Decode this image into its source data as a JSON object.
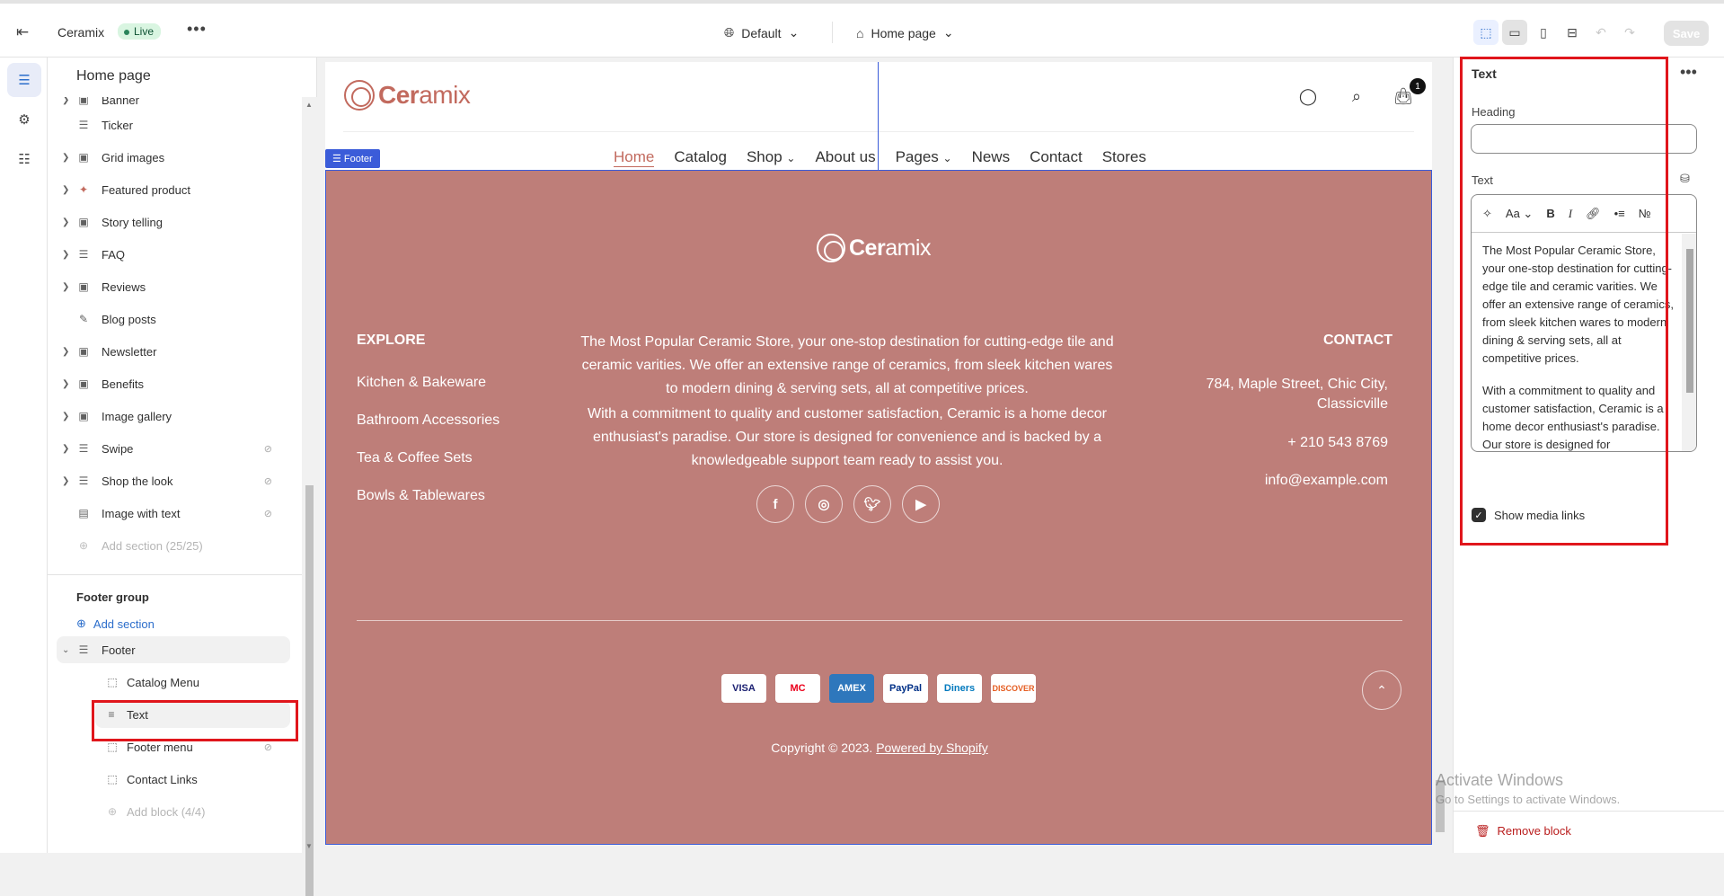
{
  "topbar": {
    "store_name": "Ceramix",
    "status": "Live",
    "theme_label": "Default",
    "page_label": "Home page",
    "save_label": "Save"
  },
  "sidebar": {
    "title": "Home page",
    "sections": [
      {
        "label": "Banner",
        "icon": "image-icon",
        "expandable": true,
        "hidden": false
      },
      {
        "label": "Ticker",
        "icon": "section-icon",
        "expandable": false,
        "hidden": false
      },
      {
        "label": "Grid images",
        "icon": "image-icon",
        "expandable": true,
        "hidden": false
      },
      {
        "label": "Featured product",
        "icon": "product-icon",
        "expandable": true,
        "hidden": false
      },
      {
        "label": "Story telling",
        "icon": "image-icon",
        "expandable": true,
        "hidden": false
      },
      {
        "label": "FAQ",
        "icon": "section-icon",
        "expandable": true,
        "hidden": false
      },
      {
        "label": "Reviews",
        "icon": "image-icon",
        "expandable": true,
        "hidden": false
      },
      {
        "label": "Blog posts",
        "icon": "blog-icon",
        "expandable": false,
        "hidden": false
      },
      {
        "label": "Newsletter",
        "icon": "image-icon",
        "expandable": true,
        "hidden": false
      },
      {
        "label": "Benefits",
        "icon": "image-icon",
        "expandable": true,
        "hidden": false
      },
      {
        "label": "Image gallery",
        "icon": "image-icon",
        "expandable": true,
        "hidden": false
      },
      {
        "label": "Swipe",
        "icon": "section-icon",
        "expandable": true,
        "hidden": true
      },
      {
        "label": "Shop the look",
        "icon": "section-icon",
        "expandable": true,
        "hidden": true
      },
      {
        "label": "Image with text",
        "icon": "image-text-icon",
        "expandable": false,
        "hidden": true
      }
    ],
    "add_section_limited": "Add section (25/25)",
    "footer_group_title": "Footer group",
    "add_section": "Add section",
    "footer_section": "Footer",
    "footer_blocks": [
      {
        "label": "Catalog Menu",
        "hidden": false
      },
      {
        "label": "Text",
        "hidden": false
      },
      {
        "label": "Footer menu",
        "hidden": true
      },
      {
        "label": "Contact Links",
        "hidden": false
      }
    ],
    "add_block": "Add block (4/4)"
  },
  "preview": {
    "logo": {
      "bold": "Cer",
      "thin": "amix"
    },
    "cart_count": "1",
    "nav": [
      "Home",
      "Catalog",
      "Shop",
      "About us",
      "Pages",
      "News",
      "Contact",
      "Stores"
    ],
    "footer_tag": "Footer",
    "footer": {
      "explore_heading": "EXPLORE",
      "explore_links": [
        "Kitchen & Bakeware",
        "Bathroom Accessories",
        "Tea & Coffee Sets",
        "Bowls & Tablewares"
      ],
      "paragraph1": "The Most Popular Ceramic Store, your one-stop destination for cutting-edge tile and ceramic varities. We offer an extensive range of ceramics, from sleek kitchen wares to modern dining & serving sets, all at competitive prices.",
      "paragraph2": "With a commitment to quality and customer satisfaction, Ceramic is a home decor enthusiast's paradise. Our store is designed for convenience and is backed by a knowledgeable support team ready to assist you.",
      "contact_heading": "CONTACT",
      "address": "784, Maple Street, Chic City, Classicville",
      "phone": "+ 210 543 8769",
      "email": "info@example.com",
      "payments": [
        "VISA",
        "MC",
        "AMEX",
        "PayPal",
        "Diners",
        "DISCOVER"
      ],
      "copyright": "Copyright © 2023.",
      "powered_by": "Powered by Shopify"
    }
  },
  "panel": {
    "title": "Text",
    "heading_label": "Heading",
    "heading_value": "",
    "text_label": "Text",
    "text_p1": "The Most Popular Ceramic Store, your one-stop destination for cutting-edge tile and ceramic varities. We offer an extensive range of ceramics, from sleek kitchen wares to modern dining & serving sets, all at competitive prices.",
    "text_p2": "With a commitment to quality and customer satisfaction, Ceramic is a home decor enthusiast's paradise. Our store is designed for convenience and is backed by a knowledgeable support team ready to assist you.",
    "show_media_label": "Show media links",
    "show_media_checked": true,
    "remove_label": "Remove block"
  },
  "watermark": {
    "line1": "Activate Windows",
    "line2": "Go to Settings to activate Windows."
  },
  "colors": {
    "accent": "#2c6ecb",
    "brand": "#c26a5e",
    "footer_bg": "#be7e79",
    "highlight": "#e0161c"
  }
}
